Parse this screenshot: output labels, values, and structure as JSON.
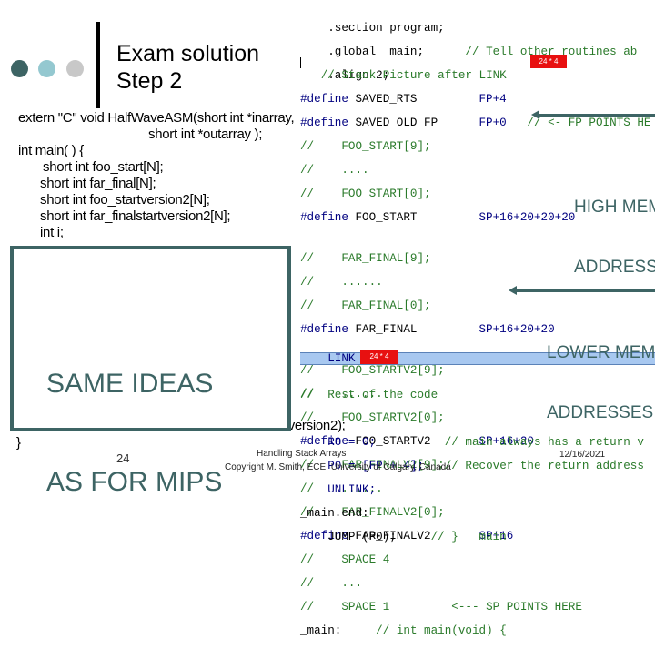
{
  "slide": {
    "title_line1": "Exam solution",
    "title_line2": "Step 2",
    "dots_colors": [
      "#3d6464",
      "#94c8d0",
      "#c8c8c8"
    ],
    "accent_color": "#3d6464",
    "page_number": "24",
    "footer_title": "Handling Stack Arrays",
    "footer_copyright": "Copyright M. Smith, ECE, University of Calgary, Canada",
    "date": "12/16/2021"
  },
  "c_code": {
    "line1": "extern \"C\" void HalfWaveASM(short int *inarray,",
    "line2": "short int *outarray );",
    "line3": "int main( ) {",
    "line4": "short int foo_start[N];",
    "line5": "short int far_final[N];",
    "line6": "short int foo_startversion2[N];",
    "line7": "short int far_finalstartversion2[N];",
    "line8": "int i;",
    "hidden_fragment": "rversion2);",
    "closing_brace": "}"
  },
  "callout_box": {
    "line1": "SAME IDEAS",
    "line2": "AS FOR MIPS"
  },
  "annotations": {
    "high_mem_1": "HIGH MEM",
    "high_mem_2": "ADDRESS",
    "low_mem_1": "LOWER MEMO",
    "low_mem_2": "ADDRESSES",
    "badge_top": "24 * 4",
    "badge_link": "24 * 4"
  },
  "asm": {
    "l1": ".section program;",
    "l2a": ".global _main;",
    "l2b": "// Tell other routines ab",
    "l3": ".align 2;",
    "l4": "// Stack Picture after LINK",
    "l5a": "#define",
    "l5b": " SAVED_RTS         ",
    "l5c": "FP+4",
    "l6a": "#define",
    "l6b": " SAVED_OLD_FP      ",
    "l6c": "FP+0",
    "l6d": "   // <- FP POINTS HE",
    "l7": "//    FOO_START[9];",
    "l8": "//    ....",
    "l9": "//    FOO_START[0];",
    "l10a": "#define",
    "l10b": " FOO_START         ",
    "l10c": "SP+16+20+20+20",
    "l11": "//    FAR_FINAL[9];",
    "l12": "//    ......",
    "l13": "//    FAR_FINAL[0];",
    "l14a": "#define",
    "l14b": " FAR_FINAL         ",
    "l14c": "SP+16+20+20",
    "l15": "//    FOO_STARTV2[9];",
    "l16": "//    ......",
    "l17": "//    FOO_STARTV2[0];",
    "l18a": "#define",
    "l18b": " FOO_STARTV2       ",
    "l18c": "SP+16+20",
    "l19": "//    FAR_FINALV2[9];",
    "l20": "//    ......",
    "l21": "//    FAR_FINALV2[0];",
    "l22a": "#define",
    "l22b": " FAR_FINALV2       ",
    "l22c": "SP+16",
    "l23": "//    SPACE 4",
    "l24": "//    ...",
    "l25a": "//    SPACE 1",
    "l25b": "<--- SP POINTS HERE",
    "l26a": "_main:",
    "l26b": "// int main(void) {",
    "l27": "LINK",
    "l28": "//  Rest of the code",
    "l29a": "R0 = 0;",
    "l29b": "// main always has a return v",
    "l30a": "P0 = [FP + 4];",
    "l30b": "// Recover the return address",
    "l31": "UNLINK;",
    "l32": "_main.end:",
    "l33a": "JUMP (P0);",
    "l33b": "// }   main"
  }
}
